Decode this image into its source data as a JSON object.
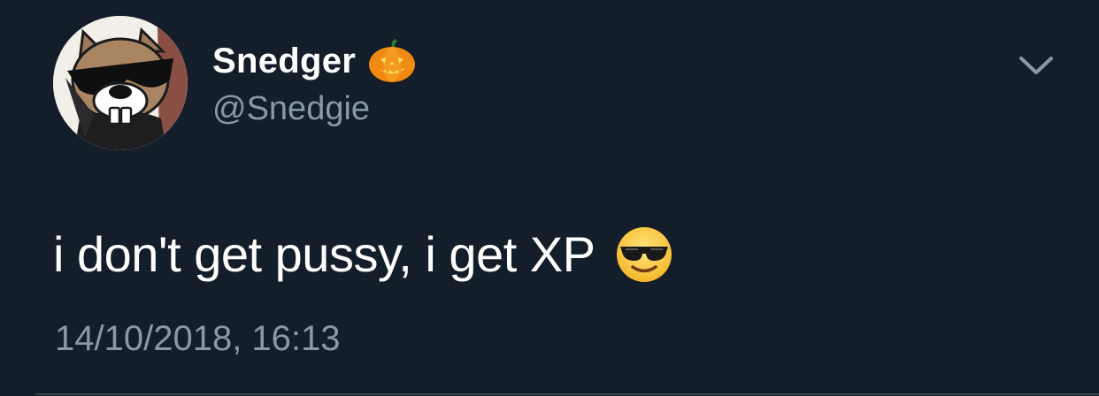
{
  "tweet": {
    "author": {
      "display_name": "Snedger",
      "display_name_emoji": "jack-o-lantern-icon",
      "handle": "@Snedgie",
      "avatar": "beaver-with-sunglasses-avatar"
    },
    "text": "i don't get pussy, i get XP",
    "text_emoji": "smiling-face-with-sunglasses-icon",
    "timestamp": "14/10/2018, 16:13",
    "menu_icon": "chevron-down-icon"
  },
  "colors": {
    "background": "#141d2a",
    "primary_text": "#ffffff",
    "secondary_text": "#8899a6",
    "divider": "#38444d"
  }
}
